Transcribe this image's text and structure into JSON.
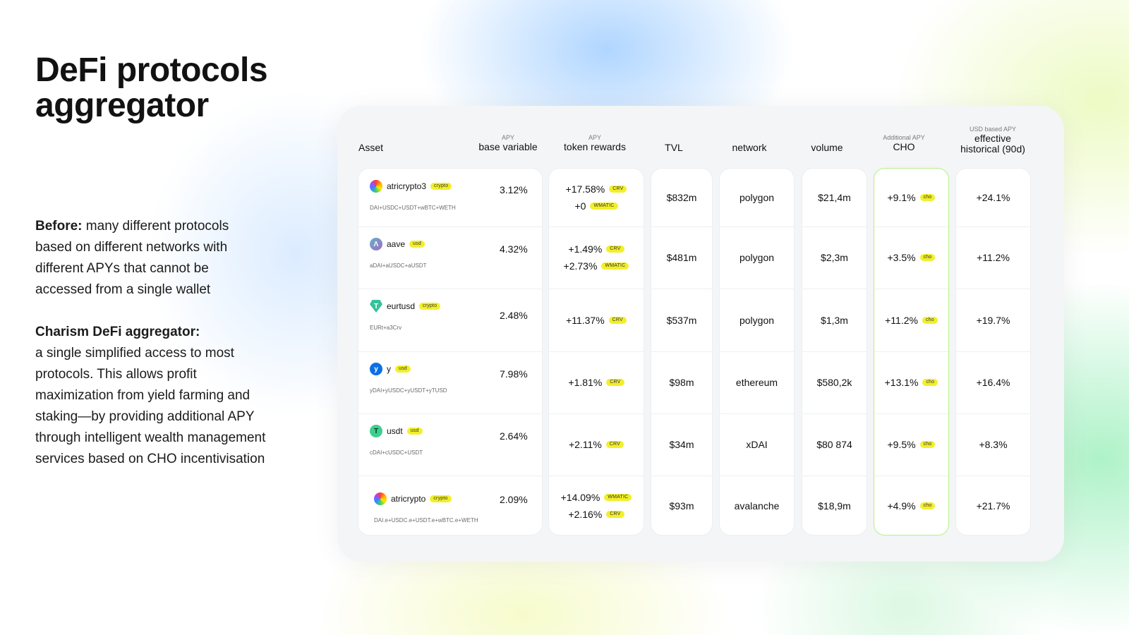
{
  "page": {
    "title": "DeFi protocols aggregator",
    "before_label": "Before:",
    "before_text": " many different protocols based on different networks with different APYs that cannot be accessed from a single wallet",
    "charism_label": "Charism DeFi aggregator:",
    "charism_text": "a single simplified access to most protocols. This allows profit maximization from yield farming and staking—by providing additional APY through intelligent wealth management services based on CHO incentivisation"
  },
  "table": {
    "headers": {
      "asset": "Asset",
      "base_small": "APY",
      "base_main": "base variable",
      "rewards_small": "APY",
      "rewards_main": "token rewards",
      "tvl": "TVL",
      "network": "network",
      "volume": "volume",
      "cho_small": "Additional APY",
      "cho_main": "CHO",
      "hist_small": "USD based APY",
      "hist_main1": "effective",
      "hist_main2": "historical (90d)"
    },
    "rows": [
      {
        "asset": "atricrypto3",
        "tag": "crypto",
        "sub": "DAI+USDC+USDT+wBTC+WETH",
        "logo": "rainbow-swirl-icon",
        "base_apy": "3.12%",
        "rewards": [
          {
            "value": "+17.58%",
            "token": "CRV"
          },
          {
            "value": "+0",
            "token": "WMATIC"
          }
        ],
        "tvl": "$832m",
        "network": "polygon",
        "volume": "$21,4m",
        "cho": "+9.1%",
        "cho_tag": "cho",
        "historical": "+24.1%"
      },
      {
        "asset": "aave",
        "tag": "usd",
        "sub": "aDAI+aUSDC+aUSDT",
        "logo": "aave-icon",
        "base_apy": "4.32%",
        "rewards": [
          {
            "value": "+1.49%",
            "token": "CRV"
          },
          {
            "value": "+2.73%",
            "token": "WMATIC"
          }
        ],
        "tvl": "$481m",
        "network": "polygon",
        "volume": "$2,3m",
        "cho": "+3.5%",
        "cho_tag": "cho",
        "historical": "+11.2%"
      },
      {
        "asset": "eurtusd",
        "tag": "crypto",
        "sub": "EURt+a3Crv",
        "logo": "tether-diamond-icon",
        "base_apy": "2.48%",
        "rewards": [
          {
            "value": "+11.37%",
            "token": "CRV"
          }
        ],
        "tvl": "$537m",
        "network": "polygon",
        "volume": "$1,3m",
        "cho": "+11.2%",
        "cho_tag": "cho",
        "historical": "+19.7%"
      },
      {
        "asset": "y",
        "tag": "usd",
        "sub": "yDAI+yUSDC+yUSDT+yTUSD",
        "logo": "yearn-icon",
        "base_apy": "7.98%",
        "rewards": [
          {
            "value": "+1.81%",
            "token": "CRV"
          }
        ],
        "tvl": "$98m",
        "network": "ethereum",
        "volume": "$580,2k",
        "cho": "+13.1%",
        "cho_tag": "cho",
        "historical": "+16.4%"
      },
      {
        "asset": "usdt",
        "tag": "usd",
        "sub": "cDAI+cUSDC+USDT",
        "logo": "tether-icon",
        "base_apy": "2.64%",
        "rewards": [
          {
            "value": "+2.11%",
            "token": "CRV"
          }
        ],
        "tvl": "$34m",
        "network": "xDAI",
        "volume": "$80 874",
        "cho": "+9.5%",
        "cho_tag": "cho",
        "historical": "+8.3%"
      },
      {
        "asset": "atricrypto",
        "tag": "crypto",
        "sub": "DAI.e+USDC.e+USDT.e+wBTC.e+WETH",
        "logo": "rainbow-swirl-icon",
        "base_apy": "2.09%",
        "rewards": [
          {
            "value": "+14.09%",
            "token": "WMATIC"
          },
          {
            "value": "+2.16%",
            "token": "CRV"
          }
        ],
        "tvl": "$93m",
        "network": "avalanche",
        "volume": "$18,9m",
        "cho": "+4.9%",
        "cho_tag": "cho",
        "historical": "+21.7%"
      }
    ]
  },
  "colors": {
    "tag_yellow": "#f2ef2b",
    "cho_border": "#b6ef8a",
    "card_bg": "#f4f5f6"
  }
}
